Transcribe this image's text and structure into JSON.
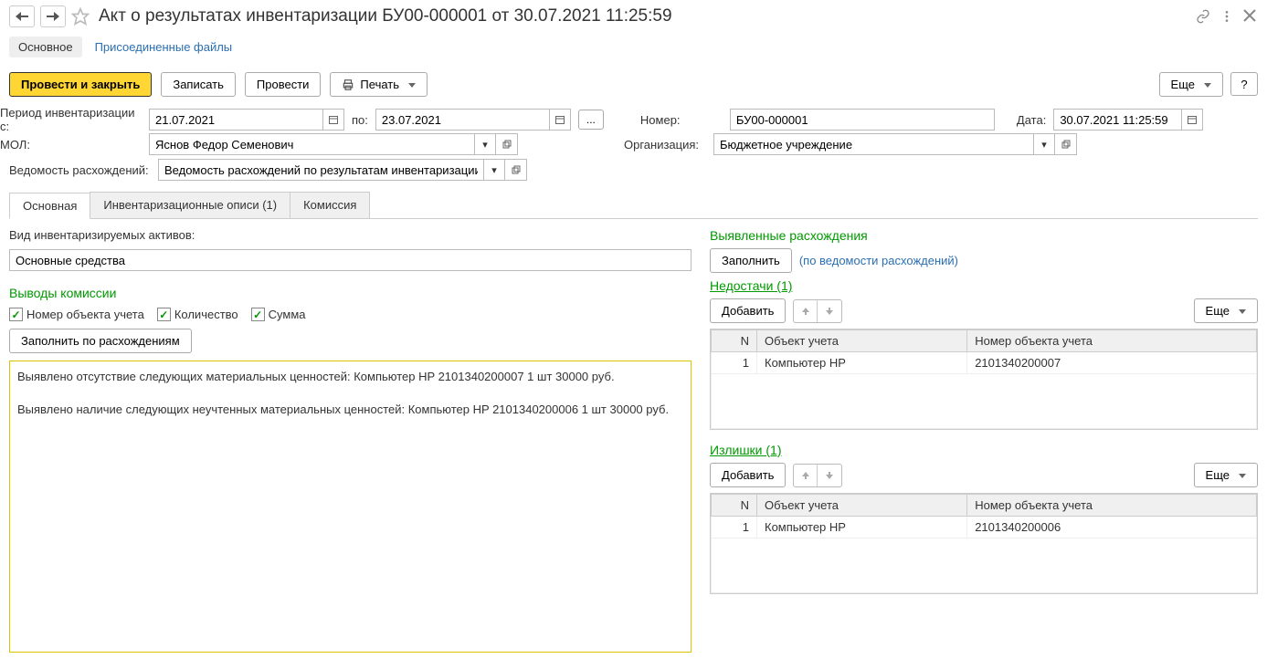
{
  "header": {
    "title": "Акт о результатах инвентаризации БУ00-000001 от 30.07.2021 11:25:59"
  },
  "toplinks": {
    "main": "Основное",
    "attached": "Присоединенные файлы"
  },
  "toolbar": {
    "post_close": "Провести и закрыть",
    "save": "Записать",
    "post": "Провести",
    "print": "Печать",
    "more": "Еще",
    "help": "?"
  },
  "form": {
    "period_label": "Период инвентаризации с:",
    "date_from": "21.07.2021",
    "to_label": "по:",
    "date_to": "23.07.2021",
    "dots": "...",
    "number_label": "Номер:",
    "number": "БУ00-000001",
    "date_label": "Дата:",
    "date": "30.07.2021 11:25:59",
    "mol_label": "МОЛ:",
    "mol": "Яснов Федор Семенович",
    "org_label": "Организация:",
    "org": "Бюджетное учреждение",
    "disc_label": "Ведомость расхождений:",
    "disc": "Ведомость расхождений по результатам инвентаризации БУ"
  },
  "tabs": {
    "t1": "Основная",
    "t2": "Инвентаризационные описи (1)",
    "t3": "Комиссия"
  },
  "left": {
    "asset_type_label": "Вид инвентаризируемых активов:",
    "asset_type": "Основные средства",
    "conclusions": "Выводы комиссии",
    "chk_num": "Номер объекта учета",
    "chk_qty": "Количество",
    "chk_sum": "Сумма",
    "fill_by_disc": "Заполнить по расхождениям",
    "textarea": "Выявлено отсутствие следующих материальных ценностей: Компьютер HP 2101340200007 1 шт 30000 руб.\n\nВыявлено наличие следующих неучтенных материальных ценностей: Компьютер HP 2101340200006 1 шт 30000 руб."
  },
  "right": {
    "discrepancies": "Выявленные расхождения",
    "fill": "Заполнить",
    "by_disc_link": "(по ведомости расхождений)",
    "shortages": "Недостачи (1)",
    "add": "Добавить",
    "more": "Еще",
    "col_n": "N",
    "col_obj": "Объект учета",
    "col_num": "Номер объекта учета",
    "shortage_rows": [
      {
        "n": "1",
        "obj": "Компьютер HP",
        "num": "2101340200007"
      }
    ],
    "surplus": "Излишки (1)",
    "surplus_rows": [
      {
        "n": "1",
        "obj": "Компьютер HP",
        "num": "2101340200006"
      }
    ]
  }
}
